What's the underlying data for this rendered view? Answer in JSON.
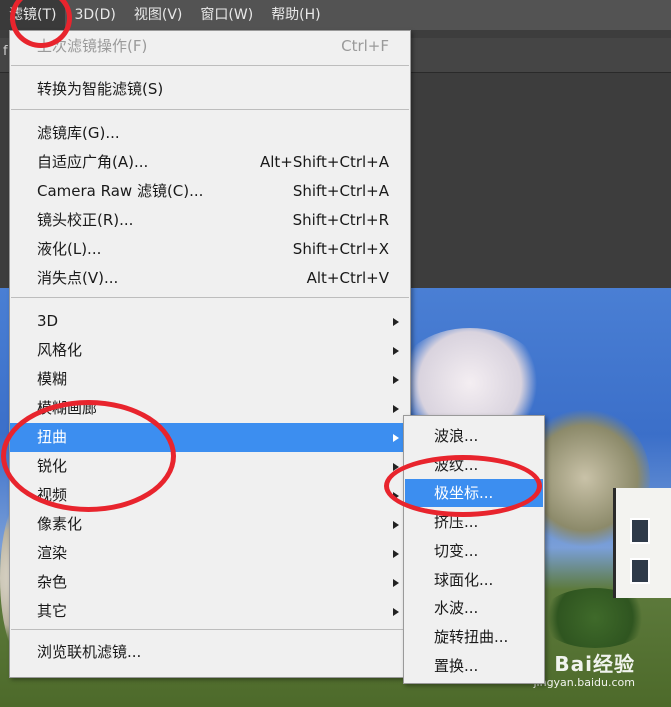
{
  "menubar": {
    "items": [
      {
        "label": "滤镜(T)"
      },
      {
        "label": "3D(D)"
      },
      {
        "label": "视图(V)"
      },
      {
        "label": "窗口(W)"
      },
      {
        "label": "帮助(H)"
      }
    ]
  },
  "tab_fragment": "f",
  "filter_menu": {
    "items": [
      {
        "label": "上次滤镜操作(F)",
        "shortcut": "Ctrl+F"
      },
      {
        "label": "转换为智能滤镜(S)"
      },
      {
        "label": "滤镜库(G)..."
      },
      {
        "label": "自适应广角(A)...",
        "shortcut": "Alt+Shift+Ctrl+A"
      },
      {
        "label": "Camera Raw 滤镜(C)...",
        "shortcut": "Shift+Ctrl+A"
      },
      {
        "label": "镜头校正(R)...",
        "shortcut": "Shift+Ctrl+R"
      },
      {
        "label": "液化(L)...",
        "shortcut": "Shift+Ctrl+X"
      },
      {
        "label": "消失点(V)...",
        "shortcut": "Alt+Ctrl+V"
      },
      {
        "label": "3D"
      },
      {
        "label": "风格化"
      },
      {
        "label": "模糊"
      },
      {
        "label": "模糊画廊"
      },
      {
        "label": "扭曲"
      },
      {
        "label": "锐化"
      },
      {
        "label": "视频"
      },
      {
        "label": "像素化"
      },
      {
        "label": "渲染"
      },
      {
        "label": "杂色"
      },
      {
        "label": "其它"
      },
      {
        "label": "浏览联机滤镜..."
      }
    ]
  },
  "distort_submenu": {
    "items": [
      {
        "label": "波浪..."
      },
      {
        "label": "波纹..."
      },
      {
        "label": "极坐标..."
      },
      {
        "label": "挤压..."
      },
      {
        "label": "切变..."
      },
      {
        "label": "球面化..."
      },
      {
        "label": "水波..."
      },
      {
        "label": "旋转扭曲..."
      },
      {
        "label": "置换..."
      }
    ]
  },
  "watermark": {
    "brand": "Bai经验",
    "url": "jingyan.baidu.com"
  },
  "colors": {
    "highlight": "#3c8ef0",
    "annotation_red": "#e8242d",
    "menubar_bg": "#535353"
  }
}
